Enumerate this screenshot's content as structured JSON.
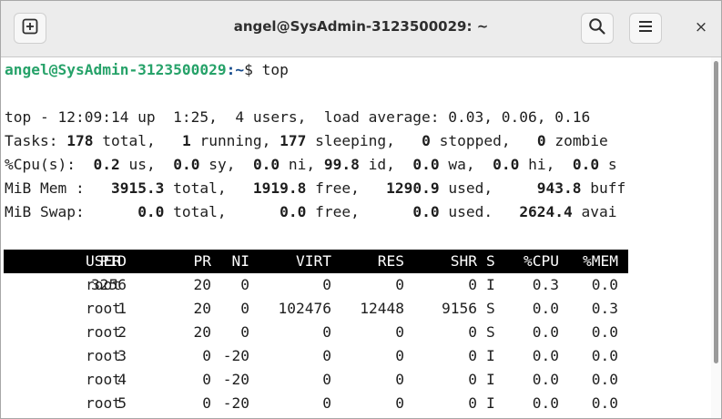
{
  "window": {
    "title": "angel@SysAdmin-3123500029: ~",
    "new_tab_icon": "new-tab-icon",
    "search_icon": "search-icon",
    "menu_icon": "hamburger-menu-icon",
    "close_label": "×"
  },
  "prompt": {
    "user_host": "angel@SysAdmin-3123500029",
    "path": ":~",
    "symbol": "$ ",
    "command": "top"
  },
  "summary": {
    "line1": "top - 12:09:14 up  1:25,  4 users,  load average: 0.03, 0.06, 0.16",
    "tasks": {
      "label": "Tasks: ",
      "total": "178",
      "total_l": " total,   ",
      "running": "1",
      "running_l": " running, ",
      "sleeping": "177",
      "sleeping_l": " sleeping,   ",
      "stopped": "0",
      "stopped_l": " stopped,   ",
      "zombie": "0",
      "zombie_l": " zombie"
    },
    "cpu": {
      "label": "%Cpu(s):  ",
      "us": "0.2",
      "us_l": " us,  ",
      "sy": "0.0",
      "sy_l": " sy,  ",
      "ni": "0.0",
      "ni_l": " ni, ",
      "id": "99.8",
      "id_l": " id,  ",
      "wa": "0.0",
      "wa_l": " wa,  ",
      "hi": "0.0",
      "hi_l": " hi,  ",
      "si": "0.0",
      "si_l": " s"
    },
    "mem": {
      "label": "MiB Mem :   ",
      "total": "3915.3",
      "total_l": " total,   ",
      "free": "1919.8",
      "free_l": " free,   ",
      "used": "1290.9",
      "used_l": " used,     ",
      "buff": "943.8",
      "buff_l": " buff"
    },
    "swap": {
      "label": "MiB Swap:      ",
      "total": "0.0",
      "total_l": " total,      ",
      "free": "0.0",
      "free_l": " free,      ",
      "used": "0.0",
      "used_l": " used.   ",
      "avail": "2624.4",
      "avail_l": " avai"
    }
  },
  "process_table": {
    "columns": [
      "PID",
      "USER",
      "PR",
      "NI",
      "VIRT",
      "RES",
      "SHR",
      "S",
      "%CPU",
      "%MEM"
    ],
    "rows": [
      [
        "3256",
        "root",
        "20",
        "0",
        "0",
        "0",
        "0",
        "I",
        "0.3",
        "0.0"
      ],
      [
        "1",
        "root",
        "20",
        "0",
        "102476",
        "12448",
        "9156",
        "S",
        "0.0",
        "0.3"
      ],
      [
        "2",
        "root",
        "20",
        "0",
        "0",
        "0",
        "0",
        "S",
        "0.0",
        "0.0"
      ],
      [
        "3",
        "root",
        "0",
        "-20",
        "0",
        "0",
        "0",
        "I",
        "0.0",
        "0.0"
      ],
      [
        "4",
        "root",
        "0",
        "-20",
        "0",
        "0",
        "0",
        "I",
        "0.0",
        "0.0"
      ],
      [
        "5",
        "root",
        "0",
        "-20",
        "0",
        "0",
        "0",
        "I",
        "0.0",
        "0.0"
      ]
    ]
  }
}
